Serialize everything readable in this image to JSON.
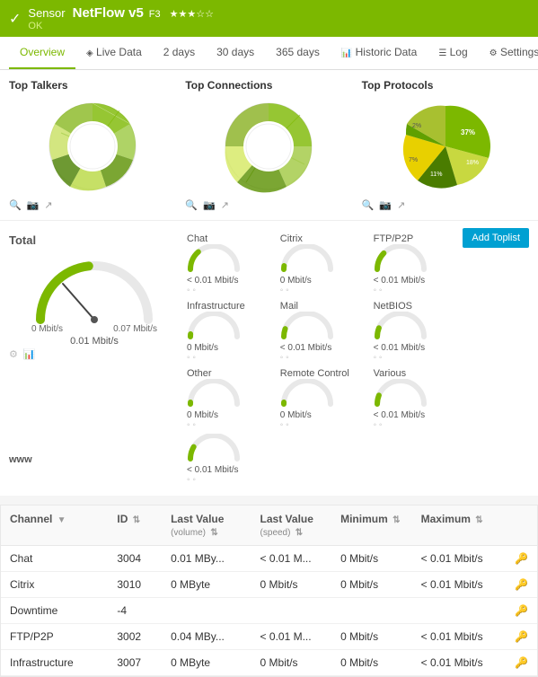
{
  "header": {
    "sensor_label": "Sensor",
    "title": "NetFlow v5",
    "version": "F3",
    "stars": "★★★☆☆",
    "status": "OK"
  },
  "nav": {
    "items": [
      {
        "id": "overview",
        "label": "Overview",
        "icon": "",
        "active": true
      },
      {
        "id": "live-data",
        "label": "Live Data",
        "icon": "◈",
        "active": false
      },
      {
        "id": "2-days",
        "label": "2 days",
        "icon": "",
        "active": false
      },
      {
        "id": "30-days",
        "label": "30 days",
        "icon": "",
        "active": false
      },
      {
        "id": "365-days",
        "label": "365 days",
        "icon": "",
        "active": false
      },
      {
        "id": "historic-data",
        "label": "Historic Data",
        "icon": "📊",
        "active": false
      },
      {
        "id": "log",
        "label": "Log",
        "icon": "☰",
        "active": false
      },
      {
        "id": "settings",
        "label": "Settings",
        "icon": "⚙",
        "active": false
      }
    ]
  },
  "top_section": {
    "top_talkers": {
      "title": "Top Talkers"
    },
    "top_connections": {
      "title": "Top Connections"
    },
    "top_protocols": {
      "title": "Top Protocols",
      "labels": [
        "37%",
        "18%",
        "11%",
        "7%",
        "2%"
      ]
    }
  },
  "add_toplist_btn": "Add Toplist",
  "gauge_section": {
    "total": {
      "label": "Total",
      "value": "0.01 Mbit/s",
      "min": "0 Mbit/s",
      "max": "0.07 Mbit/s"
    },
    "gauges": [
      {
        "label": "Chat",
        "value": "< 0.01 Mbit/s"
      },
      {
        "label": "Citrix",
        "value": "0 Mbit/s"
      },
      {
        "label": "FTP/P2P",
        "value": "< 0.01 Mbit/s"
      },
      {
        "label": "Infrastructure",
        "value": "0 Mbit/s"
      },
      {
        "label": "Mail",
        "value": "< 0.01 Mbit/s"
      },
      {
        "label": "NetBIOS",
        "value": "< 0.01 Mbit/s"
      },
      {
        "label": "Other",
        "value": "0 Mbit/s"
      },
      {
        "label": "Remote Control",
        "value": "0 Mbit/s"
      },
      {
        "label": "Various",
        "value": "< 0.01 Mbit/s"
      }
    ],
    "www": {
      "label": "www",
      "value": "< 0.01 Mbit/s"
    }
  },
  "table": {
    "columns": [
      {
        "id": "channel",
        "label": "Channel",
        "sortable": true
      },
      {
        "id": "id",
        "label": "ID",
        "sortable": true
      },
      {
        "id": "last-value-volume",
        "label": "Last Value",
        "sub": "(volume)",
        "sortable": true
      },
      {
        "id": "last-value-speed",
        "label": "Last Value",
        "sub": "(speed)",
        "sortable": true
      },
      {
        "id": "minimum",
        "label": "Minimum",
        "sortable": true
      },
      {
        "id": "maximum",
        "label": "Maximum",
        "sortable": true
      }
    ],
    "rows": [
      {
        "channel": "Chat",
        "id": "3004",
        "last_vol": "0.01 MBy...",
        "last_spd": "< 0.01 M...",
        "min": "0 Mbit/s",
        "max": "< 0.01 Mbit/s"
      },
      {
        "channel": "Citrix",
        "id": "3010",
        "last_vol": "0 MByte",
        "last_spd": "0 Mbit/s",
        "min": "0 Mbit/s",
        "max": "< 0.01 Mbit/s"
      },
      {
        "channel": "Downtime",
        "id": "-4",
        "last_vol": "",
        "last_spd": "",
        "min": "",
        "max": ""
      },
      {
        "channel": "FTP/P2P",
        "id": "3002",
        "last_vol": "0.04 MBy...",
        "last_spd": "< 0.01 M...",
        "min": "0 Mbit/s",
        "max": "< 0.01 Mbit/s"
      },
      {
        "channel": "Infrastructure",
        "id": "3007",
        "last_vol": "0 MByte",
        "last_spd": "0 Mbit/s",
        "min": "0 Mbit/s",
        "max": "< 0.01 Mbit/s"
      }
    ]
  }
}
